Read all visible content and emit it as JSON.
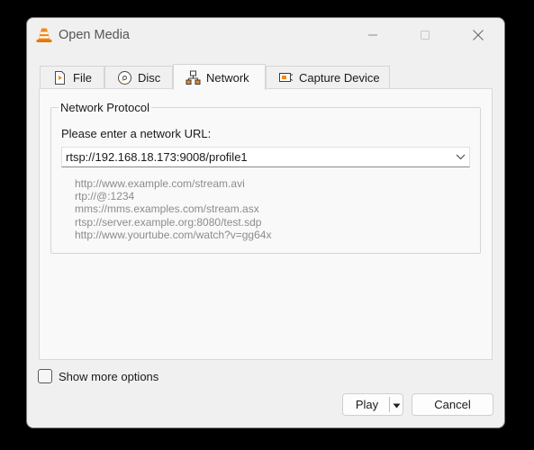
{
  "window": {
    "title": "Open Media",
    "icon": "vlc-cone-icon",
    "controls": [
      "minimize-icon",
      "maximize-icon",
      "close-icon"
    ]
  },
  "tabs": [
    {
      "label": "File",
      "icon": "file-icon",
      "active": false
    },
    {
      "label": "Disc",
      "icon": "disc-icon",
      "active": false
    },
    {
      "label": "Network",
      "icon": "network-icon",
      "active": true
    },
    {
      "label": "Capture Device",
      "icon": "capture-device-icon",
      "active": false
    }
  ],
  "network": {
    "group_title": "Network Protocol",
    "prompt": "Please enter a network URL:",
    "url_value": "rtsp://192.168.18.173:9008/profile1",
    "examples": [
      "http://www.example.com/stream.avi",
      "rtp://@:1234",
      "mms://mms.examples.com/stream.asx",
      "rtsp://server.example.org:8080/test.sdp",
      "http://www.yourtube.com/watch?v=gg64x"
    ]
  },
  "footer": {
    "show_more_label": "Show more options",
    "show_more_checked": false,
    "play_label": "Play",
    "cancel_label": "Cancel"
  },
  "colors": {
    "window_bg": "#f0f0f0",
    "panel_bg": "#f9f9f9",
    "example_text": "#8c8c8c",
    "vlc_orange": "#f08a1c"
  }
}
